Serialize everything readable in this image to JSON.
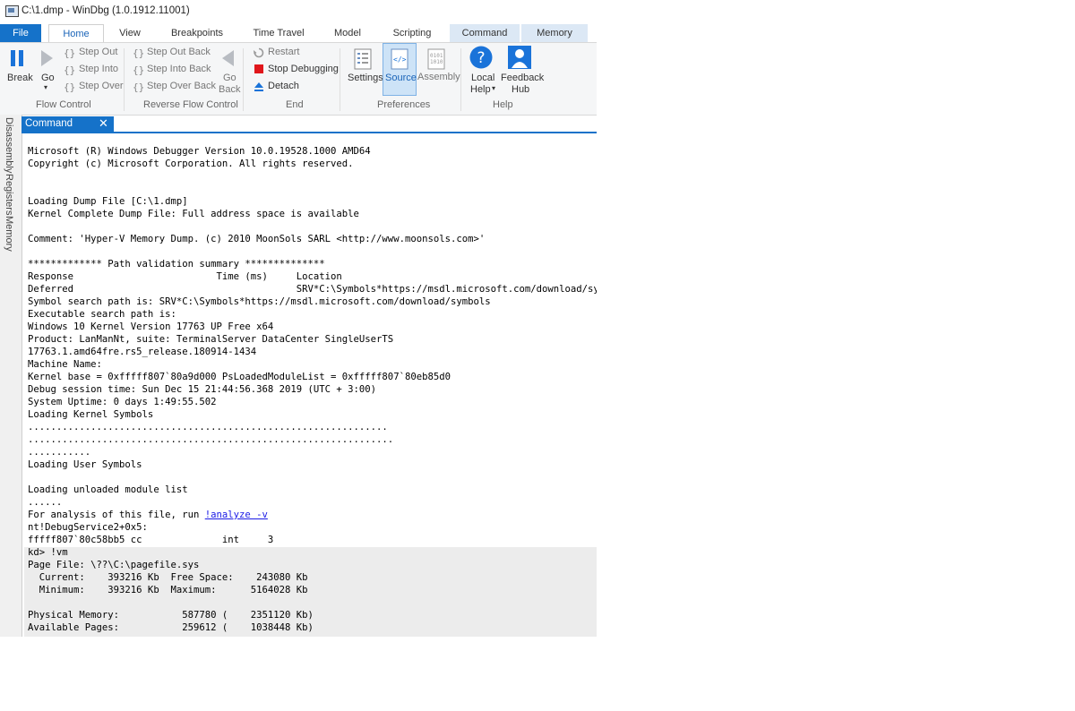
{
  "window": {
    "title": "C:\\1.dmp - WinDbg (1.0.1912.11001)"
  },
  "tabs": [
    "File",
    "Home",
    "View",
    "Breakpoints",
    "Time Travel",
    "Model",
    "Scripting",
    "Command",
    "Memory"
  ],
  "ribbon": {
    "flow_control": {
      "label": "Flow Control",
      "break": "Break",
      "go": "Go",
      "step_out": "Step Out",
      "step_into": "Step Into",
      "step_over": "Step Over"
    },
    "reverse_flow": {
      "label": "Reverse Flow Control",
      "step_out_back": "Step Out Back",
      "step_into_back": "Step Into Back",
      "step_over_back": "Step Over Back",
      "go_back_1": "Go",
      "go_back_2": "Back"
    },
    "end": {
      "label": "End",
      "restart": "Restart",
      "stop": "Stop Debugging",
      "detach": "Detach"
    },
    "preferences": {
      "label": "Preferences",
      "settings": "Settings",
      "source": "Source",
      "assembly": "Assembly"
    },
    "help": {
      "label": "Help",
      "local_help_1": "Local",
      "local_help_2": "Help",
      "feedback_1": "Feedback",
      "feedback_2": "Hub"
    }
  },
  "side_tabs": [
    "Disassembly",
    "Registers",
    "Memory"
  ],
  "doc_tab": {
    "label": "Command",
    "close": "✕"
  },
  "console": {
    "before_link": "Microsoft (R) Windows Debugger Version 10.0.19528.1000 AMD64\nCopyright (c) Microsoft Corporation. All rights reserved.\n\n\nLoading Dump File [C:\\1.dmp]\nKernel Complete Dump File: Full address space is available\n\nComment: 'Hyper-V Memory Dump. (c) 2010 MoonSols SARL <http://www.moonsols.com>'\n\n************* Path validation summary **************\nResponse                         Time (ms)     Location\nDeferred                                       SRV*C:\\Symbols*https://msdl.microsoft.com/download/symbols\nSymbol search path is: SRV*C:\\Symbols*https://msdl.microsoft.com/download/symbols\nExecutable search path is:\nWindows 10 Kernel Version 17763 UP Free x64\nProduct: LanManNt, suite: TerminalServer DataCenter SingleUserTS\n17763.1.amd64fre.rs5_release.180914-1434\nMachine Name:\nKernel base = 0xfffff807`80a9d000 PsLoadedModuleList = 0xfffff807`80eb85d0\nDebug session time: Sun Dec 15 21:44:56.368 2019 (UTC + 3:00)\nSystem Uptime: 0 days 1:49:55.502\nLoading Kernel Symbols\n...............................................................\n................................................................\n...........\nLoading User Symbols\n\nLoading unloaded module list\n......\nFor analysis of this file, run ",
    "link": "!analyze -v",
    "after_link": "\nnt!DebugService2+0x5:\nfffff807`80c58bb5 cc              int     3\nkd> !vm\nPage File: \\??\\C:\\pagefile.sys\n  Current:    393216 Kb  Free Space:    243080 Kb\n  Minimum:    393216 Kb  Maximum:      5164028 Kb\n\nPhysical Memory:           587780 (    2351120 Kb)\nAvailable Pages:           259612 (    1038448 Kb)"
  },
  "colors": {
    "accent": "#1572c9",
    "stop": "#e0161b",
    "help_blue": "#1a73d9",
    "link": "#1a1ae6"
  }
}
